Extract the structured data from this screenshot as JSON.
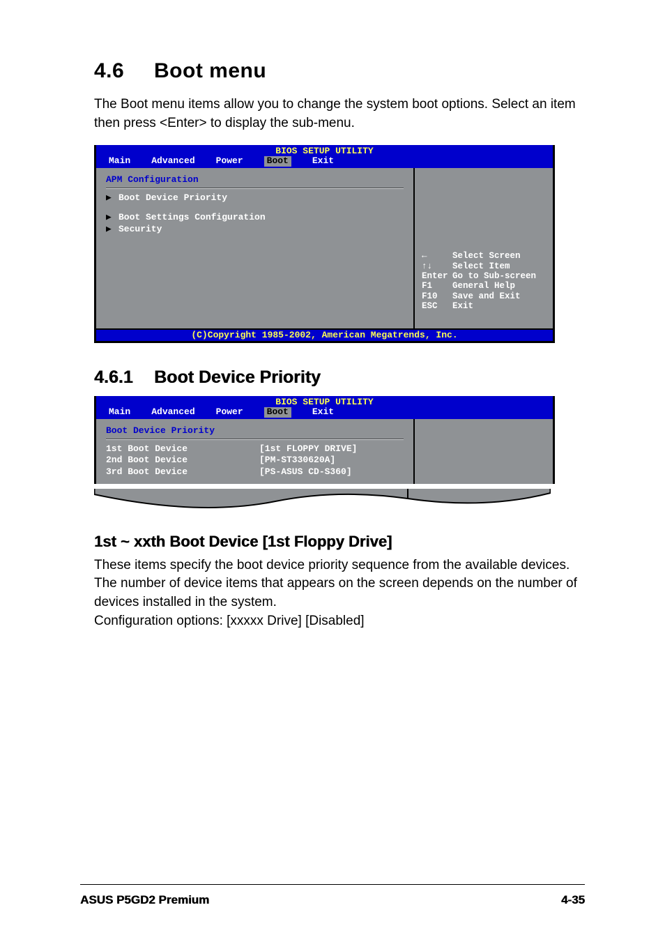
{
  "heading1_num": "4.6",
  "heading1_text": "Boot menu",
  "intro_text": "The Boot menu items allow you to change the system boot options. Select an item then press <Enter> to display the sub-menu.",
  "bios1": {
    "title": "BIOS SETUP UTILITY",
    "tabs": {
      "main": "Main",
      "advanced": "Advanced",
      "power": "Power",
      "boot": "Boot",
      "exit": "Exit"
    },
    "section": "APM Configuration",
    "items": {
      "boot_dev_priority": "Boot Device Priority",
      "boot_settings_cfg": "Boot Settings Configuration",
      "security": "Security"
    },
    "help": {
      "k1": "←",
      "v1": "Select Screen",
      "k2": "↑↓",
      "v2": "Select Item",
      "k3": "Enter",
      "v3": "Go to Sub-screen",
      "k4": "F1",
      "v4": "General Help",
      "k5": "F10",
      "v5": "Save and Exit",
      "k6": "ESC",
      "v6": "Exit"
    },
    "copyright": "(C)Copyright 1985-2002, American Megatrends, Inc."
  },
  "heading2_num": "4.6.1",
  "heading2_text": "Boot Device Priority",
  "bios2": {
    "title": "BIOS SETUP UTILITY",
    "tabs": {
      "main": "Main",
      "advanced": "Advanced",
      "power": "Power",
      "boot": "Boot",
      "exit": "Exit"
    },
    "section": "Boot Device Priority",
    "rows": [
      {
        "l": "1st Boot Device",
        "r": "[1st FLOPPY DRIVE]"
      },
      {
        "l": "2nd Boot Device",
        "r": "[PM-ST330620A]"
      },
      {
        "l": "3rd Boot Device",
        "r": "[PS-ASUS CD-S360]"
      }
    ]
  },
  "heading3": "1st ~ xxth Boot Device [1st Floppy Drive]",
  "desc_text": "These items specify the boot device priority sequence from the available devices. The number of device items that appears on the screen depends on the number of devices installed in the system.",
  "config_opts": "Configuration options: [xxxxx Drive] [Disabled]",
  "footer_left": "ASUS P5GD2 Premium",
  "footer_right": "4-35"
}
